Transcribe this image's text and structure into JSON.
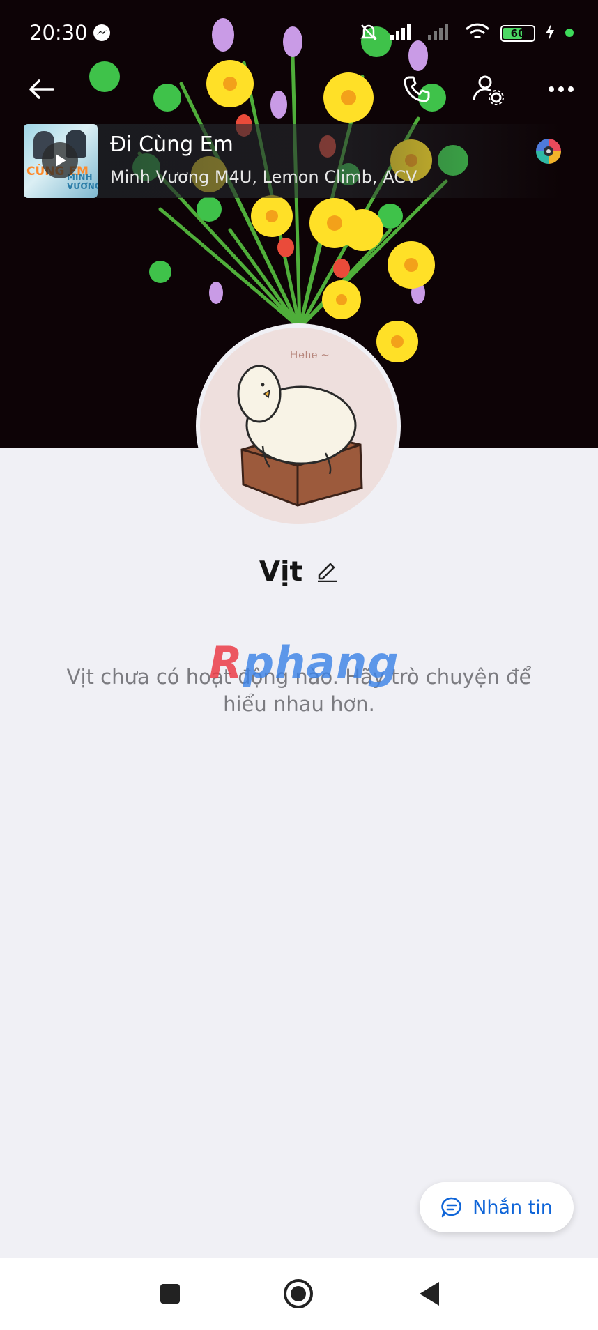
{
  "status_bar": {
    "time": "20:30",
    "battery_level": "60",
    "notification_app_icon": "messenger-icon",
    "icons": [
      "bell-muted-icon",
      "signal-icon",
      "signal-weak-icon",
      "wifi-icon",
      "battery-icon",
      "charging-icon",
      "green-dot-icon"
    ]
  },
  "top_nav": {
    "back_icon": "arrow-left-icon",
    "call_icon": "phone-icon",
    "settings_icon": "user-settings-icon",
    "more_icon": "more-horizontal-icon"
  },
  "music": {
    "title": "Đi Cùng Em",
    "artists": "Minh Vương M4U, Lemon Climb, ACV",
    "album_text_left": "CÙNG EM",
    "album_text_right": "MINH VƯƠNG",
    "play_icon": "play-icon",
    "disc_icon": "music-disc-icon"
  },
  "profile": {
    "avatar_text": "Hehe ~",
    "name": "Vịt",
    "edit_icon": "pencil-icon",
    "empty_message": "Vịt chưa có hoạt động nào. Hãy trò chuyện để hiểu nhau hơn."
  },
  "watermark": {
    "first": "R",
    "rest": "phang"
  },
  "chat_button": {
    "label": "Nhắn tin",
    "icon": "chat-bubble-icon"
  },
  "system_nav": {
    "recent_icon": "square-icon",
    "home_icon": "circle-home-icon",
    "back_icon": "triangle-back-icon"
  },
  "colors": {
    "accent": "#0f65d8",
    "background": "#f0f0f5",
    "cover": "#0d0306"
  }
}
